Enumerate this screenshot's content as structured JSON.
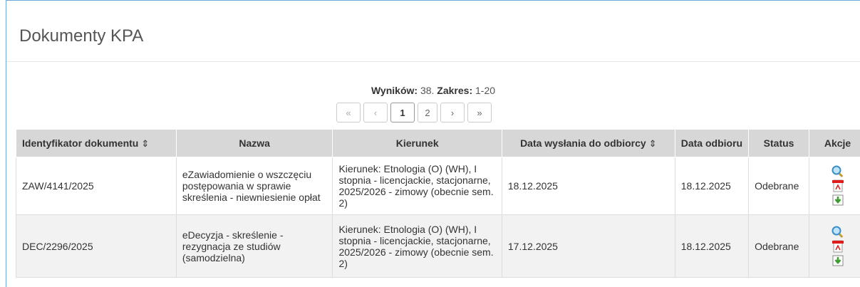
{
  "panel": {
    "title": "Dokumenty KPA"
  },
  "summary": {
    "results_label": "Wyników:",
    "results_value": "38.",
    "range_label": "Zakres:",
    "range_value": "1-20"
  },
  "pager": {
    "first": "«",
    "prev": "‹",
    "pages": [
      "1",
      "2"
    ],
    "next": "›",
    "last": "»"
  },
  "table": {
    "headers": {
      "id": "Identyfikator dokumentu",
      "name": "Nazwa",
      "direction": "Kierunek",
      "sent_date": "Data wysłania do odbiorcy",
      "received_date": "Data odbioru",
      "status": "Status",
      "actions": "Akcje"
    },
    "sort_icon": "⇕",
    "rows": [
      {
        "id": "ZAW/4141/2025",
        "name": "eZawiadomienie o wszczęciu postępowania w sprawie skreślenia - niewniesienie opłat",
        "direction": "Kierunek: Etnologia (O) (WH), I stopnia - licencjackie, stacjonarne, 2025/2026 - zimowy (obecnie sem. 2)",
        "sent_date": "18.12.2025",
        "received_date": "18.12.2025",
        "status": "Odebrane"
      },
      {
        "id": "DEC/2296/2025",
        "name": "eDecyzja - skreślenie - rezygnacja ze studiów (samodzielna)",
        "direction": "Kierunek: Etnologia (O) (WH), I stopnia - licencjackie, stacjonarne, 2025/2026 - zimowy (obecnie sem. 2)",
        "sent_date": "17.12.2025",
        "received_date": "18.12.2025",
        "status": "Odebrane"
      }
    ],
    "action_icons": [
      "magnifier-icon",
      "pdf-icon",
      "download-icon"
    ]
  }
}
